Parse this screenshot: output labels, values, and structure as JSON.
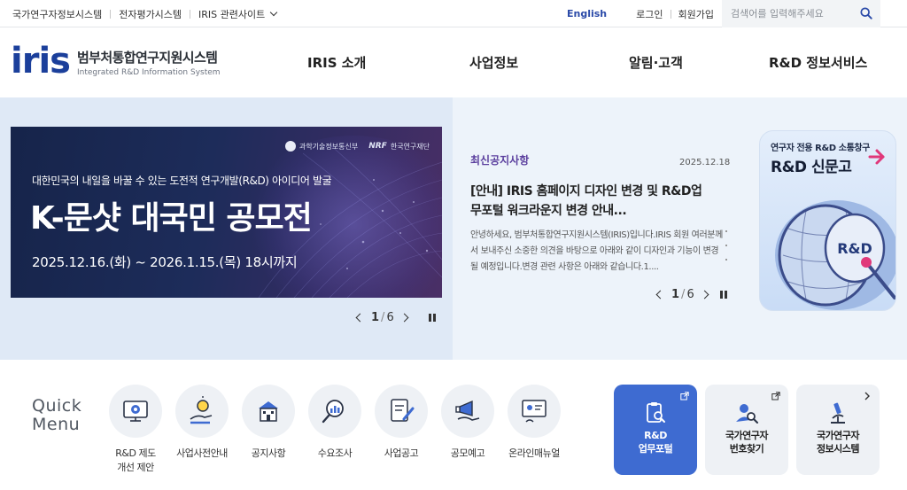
{
  "utility": {
    "links": [
      "국가연구자정보시스템",
      "전자평가시스템",
      "IRIS 관련사이트"
    ],
    "english": "English",
    "login": "로그인",
    "signup": "회원가입",
    "search_placeholder": "검색어를 입력해주세요"
  },
  "logo": {
    "wordmark": "iris",
    "ko": "범부처통합연구지원시스템",
    "en": "Integrated R&D Information System"
  },
  "gnb": [
    "IRIS 소개",
    "사업정보",
    "알림·고객",
    "R&D 정보서비스"
  ],
  "banner": {
    "org1": "과학기술정보통신부",
    "org2_mark": "NRF",
    "org2": "한국연구재단",
    "subtitle": "대한민국의 내일을 바꿀 수 있는 도전적 연구개발(R&D) 아이디어 발굴",
    "title": "K-문샷 대국민 공모전",
    "period": "2025.12.16.(화) ~ 2026.1.15.(목) 18시까지",
    "pager_current": "1",
    "pager_total": "6"
  },
  "notice": {
    "label": "최신공지사항",
    "date": "2025.12.18",
    "title": "[안내] IRIS 홈페이지 디자인 변경 및 R&D업무포털 워크라운지 변경 안내...",
    "body": "안녕하세요, 범부처통합연구지원시스템(IRIS)입니다.IRIS 회원 여러분께서 보내주신 소중한 의견을 바탕으로 아래와 같이 디자인과 기능이 변경될 예정입니다.변경 관련 사항은 아래와 같습니다.1....",
    "pager_current": "1",
    "pager_total": "6"
  },
  "promo": {
    "tag": "연구자 전용 R&D 소통창구",
    "title": "R&D 신문고",
    "drum_label": "R&D"
  },
  "quick_menu": {
    "title_line1": "Quick",
    "title_line2": "Menu",
    "items": [
      {
        "label": "R&D 제도\n개선 제안",
        "icon": "gear-screen-icon"
      },
      {
        "label": "사업사전안내",
        "icon": "lightbulb-hand-icon"
      },
      {
        "label": "공지사항",
        "icon": "building-icon"
      },
      {
        "label": "수요조사",
        "icon": "search-chart-icon"
      },
      {
        "label": "사업공고",
        "icon": "document-pen-icon"
      },
      {
        "label": "공모예고",
        "icon": "megaphone-hand-icon"
      },
      {
        "label": "온라인매뉴얼",
        "icon": "presentation-icon"
      }
    ],
    "cards": [
      {
        "label": "R&D\n업무포털",
        "icon": "clipboard-search-icon"
      },
      {
        "label": "국가연구자\n번호찾기",
        "icon": "person-search-icon"
      },
      {
        "label": "국가연구자\n정보시스템",
        "icon": "microscope-icon"
      }
    ]
  },
  "colors": {
    "brand": "#1b3f9b",
    "accent_blue": "#3e6bd1",
    "notice_purple": "#5b3f9e",
    "hero_bg": "#dfe9f6"
  }
}
